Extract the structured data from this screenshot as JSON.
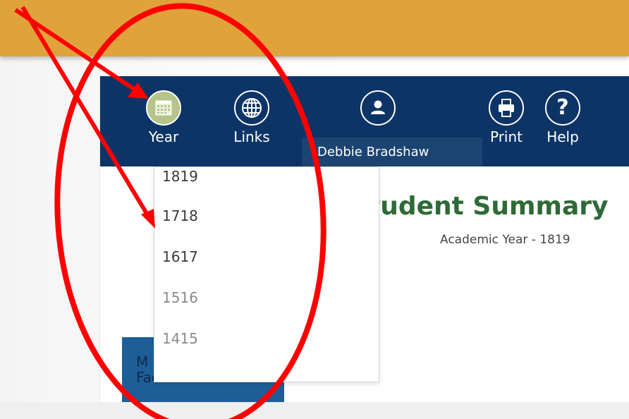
{
  "navbar": {
    "items": [
      {
        "label": "Year",
        "icon": "calendar-icon",
        "active": true
      },
      {
        "label": "Links",
        "icon": "globe-icon",
        "active": false
      },
      {
        "label": "",
        "icon": "user-icon",
        "active": false
      },
      {
        "label": "Print",
        "icon": "printer-icon",
        "active": false
      },
      {
        "label": "Help",
        "icon": "question-icon",
        "active": false
      }
    ],
    "user_name": "Debbie Bradshaw"
  },
  "year_dropdown": {
    "options": [
      "1819",
      "1718",
      "1617",
      "1516",
      "1415"
    ]
  },
  "page": {
    "title": "tudent Summary",
    "subtitle": "Academic Year - 1819"
  },
  "facebook_tile": {
    "line1": "M",
    "line2": "Facebook"
  },
  "colors": {
    "banner": "#e0a23a",
    "navbar": "#0d3466",
    "active_icon": "#b5c48a",
    "title": "#2d6a35",
    "annotation": "#ff0000"
  }
}
